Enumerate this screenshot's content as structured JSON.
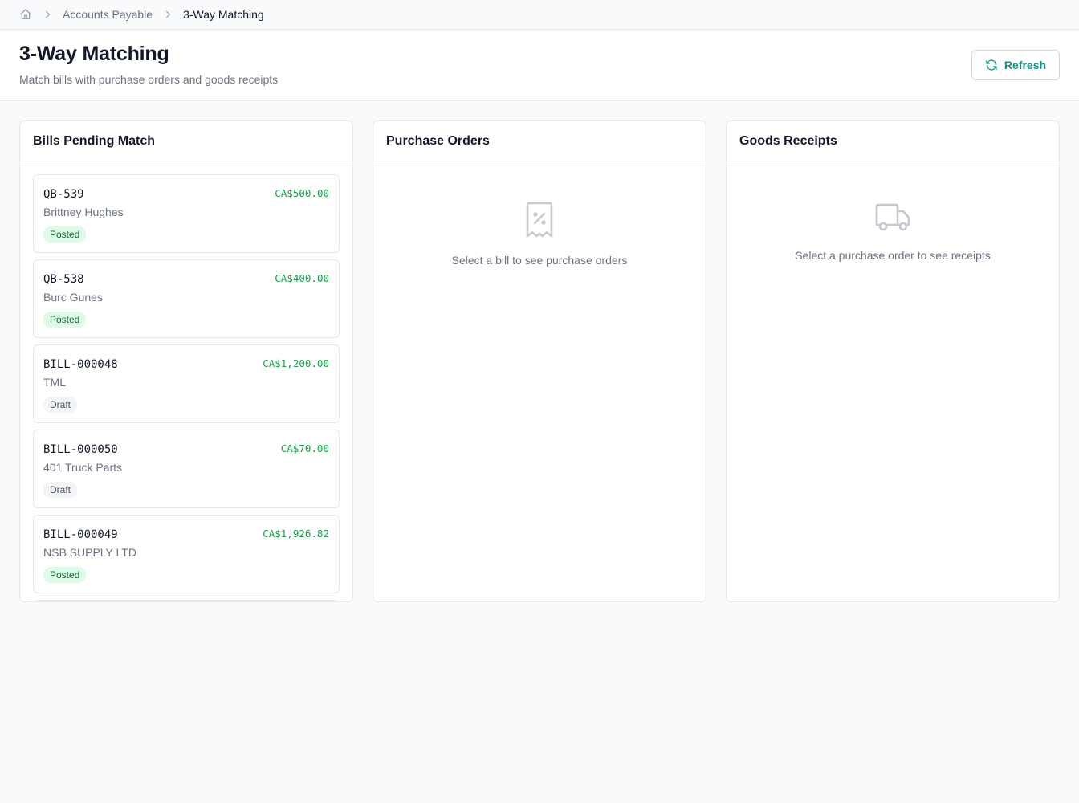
{
  "breadcrumb": {
    "items": [
      "Accounts Payable",
      "3-Way Matching"
    ]
  },
  "header": {
    "title": "3-Way Matching",
    "subtitle": "Match bills with purchase orders and goods receipts",
    "refresh_label": "Refresh"
  },
  "colors": {
    "accent": "#0d9488",
    "amount": "#16a34a",
    "posted_bg": "#dcfce7",
    "posted_text": "#166534",
    "draft_bg": "#f3f4f6",
    "draft_text": "#4b5563"
  },
  "panels": {
    "bills": {
      "title": "Bills Pending Match",
      "items": [
        {
          "number": "QB-539",
          "vendor": "Brittney Hughes",
          "amount": "CA$500.00",
          "status": "Posted"
        },
        {
          "number": "QB-538",
          "vendor": "Burc Gunes",
          "amount": "CA$400.00",
          "status": "Posted"
        },
        {
          "number": "BILL-000048",
          "vendor": "TML",
          "amount": "CA$1,200.00",
          "status": "Draft"
        },
        {
          "number": "BILL-000050",
          "vendor": "401 Truck Parts",
          "amount": "CA$70.00",
          "status": "Draft"
        },
        {
          "number": "BILL-000049",
          "vendor": "NSB SUPPLY LTD",
          "amount": "CA$1,926.82",
          "status": "Posted"
        }
      ]
    },
    "purchase_orders": {
      "title": "Purchase Orders",
      "empty_icon": "receipt-percent-icon",
      "empty_message": "Select a bill to see purchase orders"
    },
    "goods_receipts": {
      "title": "Goods Receipts",
      "empty_icon": "truck-icon",
      "empty_message": "Select a purchase order to see receipts"
    }
  }
}
